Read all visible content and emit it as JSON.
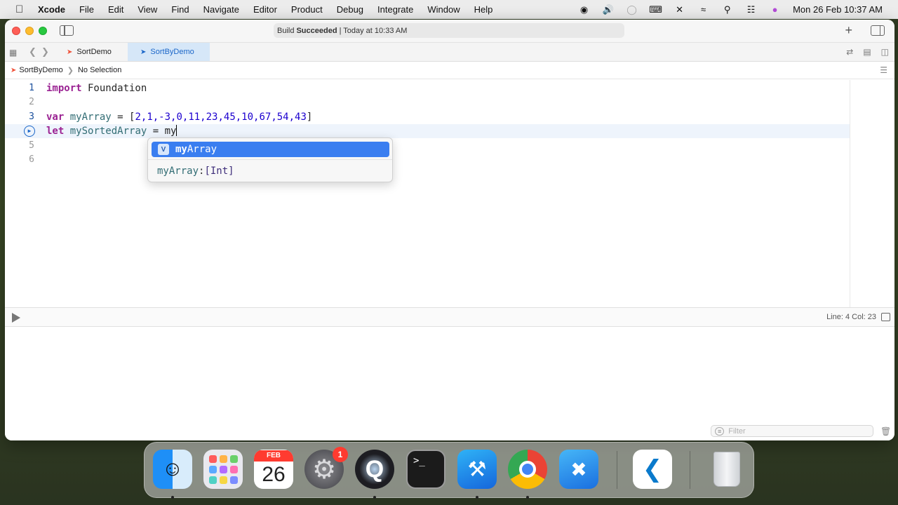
{
  "menubar": {
    "app_name": "Xcode",
    "items": [
      "File",
      "Edit",
      "View",
      "Find",
      "Navigate",
      "Editor",
      "Product",
      "Debug",
      "Integrate",
      "Window",
      "Help"
    ],
    "clock": "Mon 26 Feb  10:37 AM"
  },
  "toolbar": {
    "status_prefix": "Build",
    "status_bold": "Succeeded",
    "status_suffix": "| Today at 10:33 AM"
  },
  "tabs": [
    {
      "label": "SortDemo",
      "active": false
    },
    {
      "label": "SortByDemo",
      "active": true
    }
  ],
  "jumpbar": {
    "file": "SortByDemo",
    "selection": "No Selection"
  },
  "editor": {
    "line_numbers": [
      "1",
      "2",
      "3",
      "4",
      "5",
      "6"
    ],
    "line1": {
      "kw": "import",
      "rest": " Foundation"
    },
    "line3": {
      "kw": "var",
      "name": "myArray",
      "eq": " = [",
      "values": "2,1,-3,0,11,23,45,10,67,54,43",
      "close": "]"
    },
    "line4": {
      "kw": "let",
      "name": "mySortedArray",
      "eq": " = ",
      "typed": "my"
    }
  },
  "autocomplete": {
    "badge": "V",
    "match": "my",
    "rest": "Array",
    "detail_name": "myArray",
    "detail_sep": ": ",
    "detail_type": "[Int]"
  },
  "debug": {
    "position": "Line: 4  Col: 23"
  },
  "console": {
    "filter_placeholder": "Filter"
  },
  "dock": {
    "calendar_month": "FEB",
    "calendar_day": "26",
    "settings_badge": "1",
    "terminal_prompt": ">_"
  },
  "colors": {
    "accent": "#3a7ef0",
    "keyword": "#9b2393",
    "number": "#1c00cf",
    "identifier": "#326d74"
  }
}
